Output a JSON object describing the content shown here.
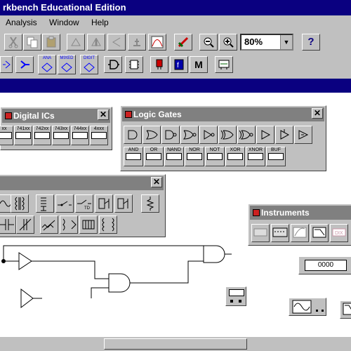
{
  "window": {
    "title": "rkbench Educational Edition"
  },
  "menu": {
    "items": [
      "Analysis",
      "Window",
      "Help"
    ]
  },
  "toolbar": {
    "zoom": "80%",
    "help_icon": "?",
    "model_label": "M",
    "ana_label": "ANA",
    "mixed_label": "MIXED",
    "digit_label": "DIGIT"
  },
  "digital_ics": {
    "title": "Digital ICs",
    "chips": [
      "xx",
      "741xx",
      "742xx",
      "743xx",
      "744xx",
      "4xxx"
    ]
  },
  "logic_gates": {
    "title": "Logic Gates",
    "labels": [
      "AND",
      "OR",
      "NAND",
      "NOR",
      "NOT",
      "XOR",
      "XNOR",
      "BUF"
    ]
  },
  "instruments": {
    "title": "Instruments",
    "counter_value": "0000"
  },
  "colors": {
    "title_active": "#0a0080",
    "title_inactive": "#808080",
    "face": "#c0c0c0"
  }
}
